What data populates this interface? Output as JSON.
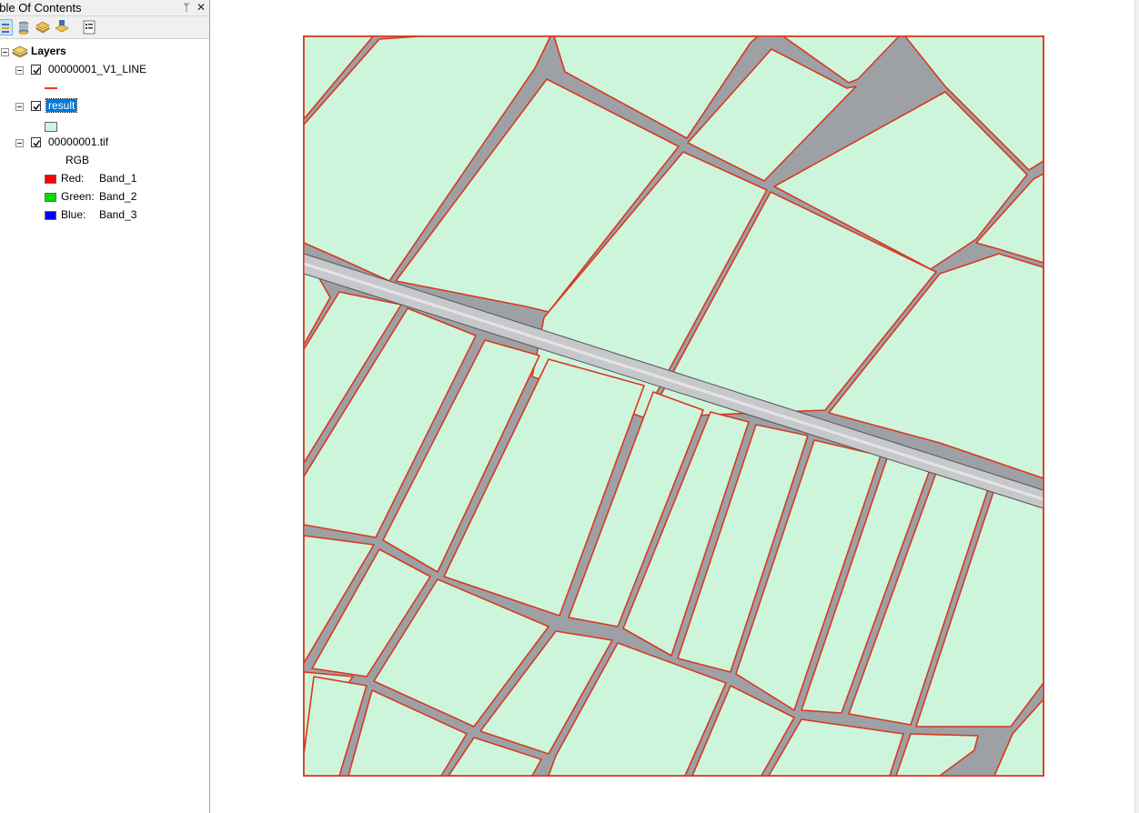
{
  "toc": {
    "title": "able Of Contents",
    "pin_icon": "pin-icon",
    "close_icon": "close-icon",
    "toolbar": [
      {
        "name": "list-by-drawing-order-icon",
        "active": true
      },
      {
        "name": "list-by-source-icon",
        "active": false
      },
      {
        "name": "list-by-visibility-icon",
        "active": false
      },
      {
        "name": "list-by-selection-icon",
        "active": false
      },
      {
        "name": "options-icon",
        "active": false
      }
    ],
    "root_label": "Layers",
    "layers": [
      {
        "label": "00000001_V1_LINE",
        "checked": true,
        "symbol": "line",
        "symbol_color": "#e8401c"
      },
      {
        "label": "result",
        "checked": true,
        "selected": true,
        "symbol": "polygon",
        "symbol_color": "#cdf5dc"
      },
      {
        "label": "00000001.tif",
        "checked": true,
        "symbol": "raster"
      }
    ],
    "raster_legend": {
      "heading": "RGB",
      "bands": [
        {
          "channel": "Red:",
          "band": "Band_1",
          "color": "#ff0000"
        },
        {
          "channel": "Green:",
          "band": "Band_2",
          "color": "#00e000"
        },
        {
          "channel": "Blue:",
          "band": "Band_3",
          "color": "#0000ff"
        }
      ]
    }
  },
  "map": {
    "background": "#ffffff",
    "polygon_fill": "#cdf5dc",
    "outline_color": "#d9381e",
    "road_color": "#9fa3a8"
  }
}
